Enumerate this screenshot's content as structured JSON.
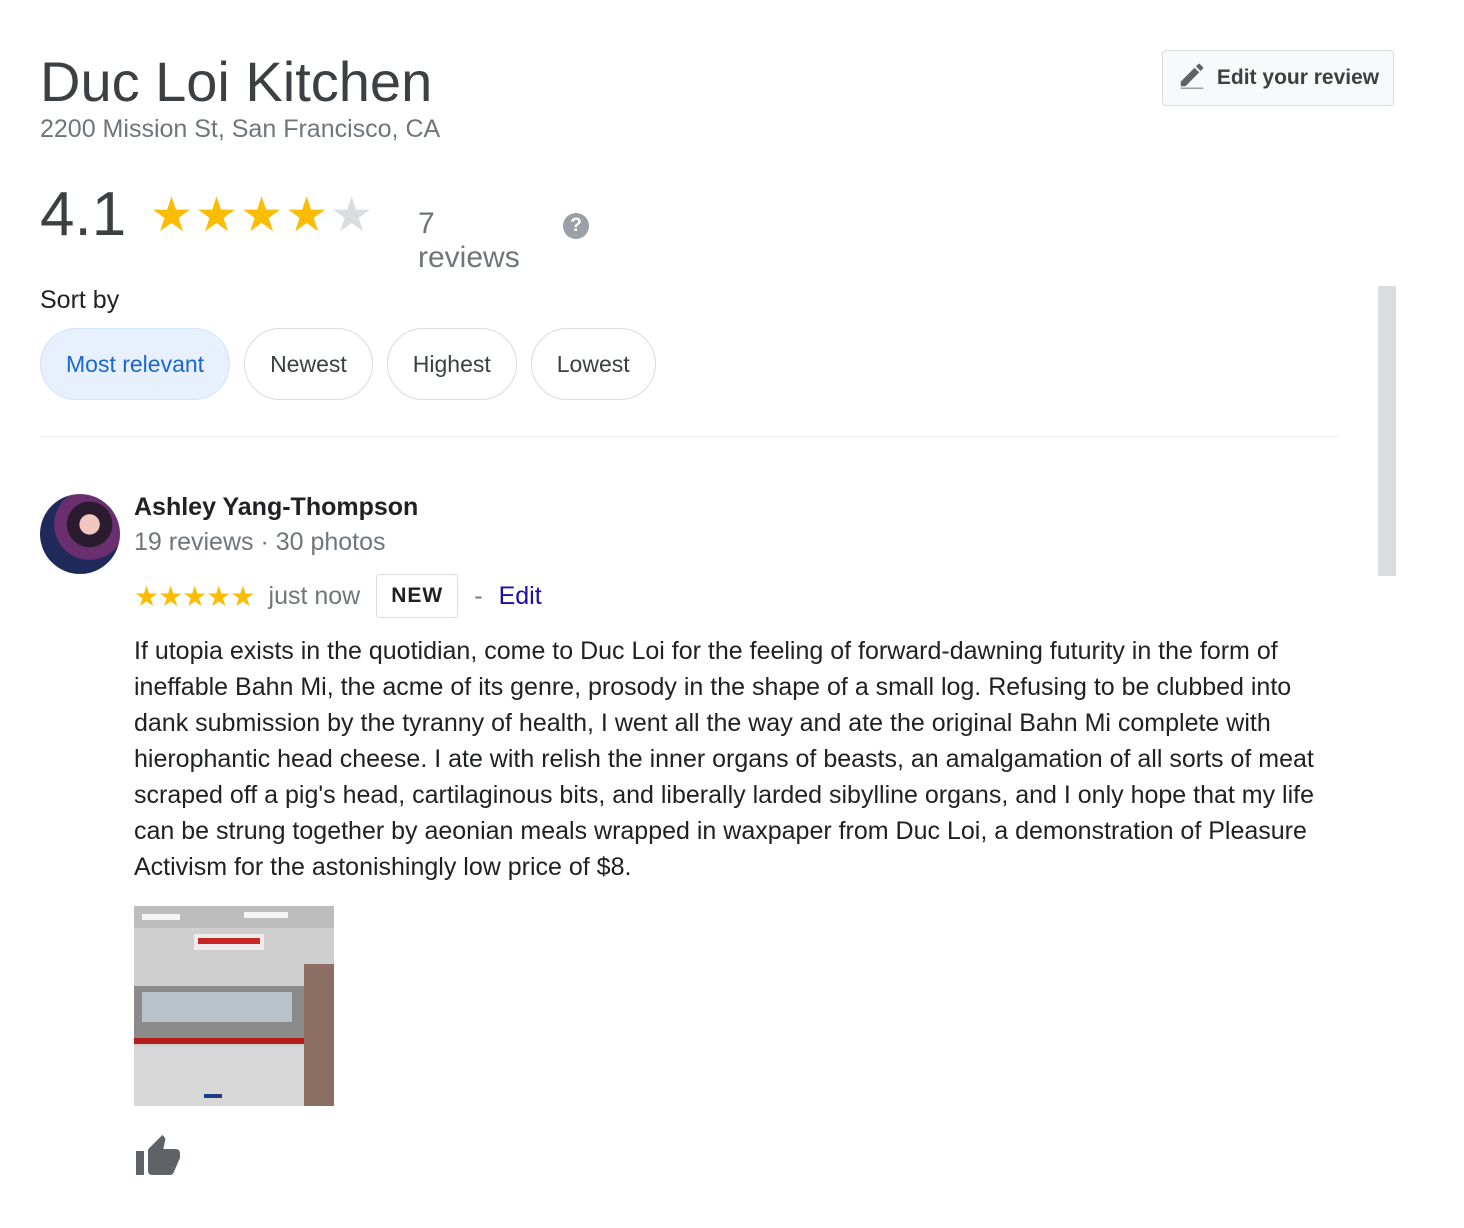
{
  "place": {
    "name": "Duc Loi Kitchen",
    "address": "2200 Mission St, San Francisco, CA"
  },
  "header": {
    "edit_button_label": "Edit your review"
  },
  "rating": {
    "value": "4.1",
    "stars": 4.1,
    "reviews_label": "7 reviews",
    "help_symbol": "?"
  },
  "sort": {
    "label": "Sort by",
    "options": [
      "Most relevant",
      "Newest",
      "Highest",
      "Lowest"
    ],
    "selected": "Most relevant"
  },
  "review": {
    "author": "Ashley Yang-Thompson",
    "author_meta": "19 reviews · 30 photos",
    "stars": 5,
    "time": "just now",
    "badge": "NEW",
    "separator": "-",
    "edit_label": "Edit",
    "text": "If utopia exists in the quotidian, come to Duc Loi for the feeling of forward-dawning futurity in the form of ineffable Bahn Mi, the acme of its genre, prosody in the shape of a small log. Refusing to be clubbed into dank submission by the tyranny of health, I went all the way and ate the original Bahn Mi complete with hierophantic head cheese. I ate with relish the inner organs of beasts, an amalgamation of all sorts of meat scraped off a pig's head, cartilaginous bits, and liberally larded sibylline organs, and I only hope that my life can be strung together by aeonian meals wrapped in waxpaper from Duc Loi, a demonstration of Pleasure Activism for the astonishingly low price of $8."
  },
  "icons": {
    "edit": "pencil-icon",
    "help": "help-icon",
    "like": "thumbs-up-icon"
  },
  "colors": {
    "star": "#fbbc04",
    "star_empty": "#dadce0",
    "chip_active_bg": "#e8f0fe",
    "chip_active_text": "#1967d2",
    "link": "#1a0dab"
  }
}
